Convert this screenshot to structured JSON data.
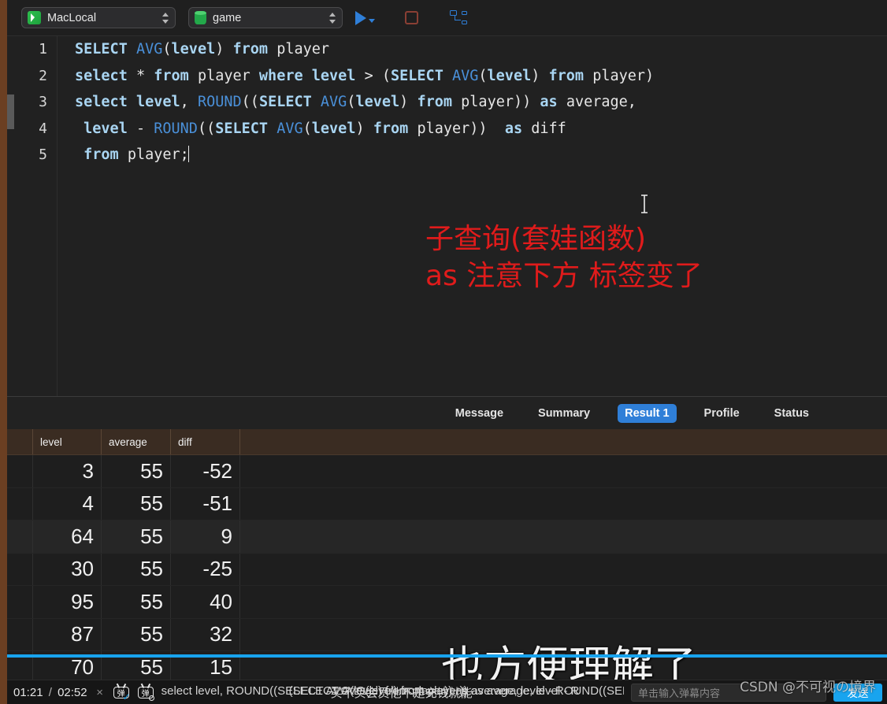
{
  "toolbar": {
    "connection": "MacLocal",
    "database": "game",
    "run_label": "run",
    "stop_label": "stop",
    "plan_label": "explain-plan"
  },
  "editor": {
    "line_numbers": [
      "1",
      "2",
      "3",
      "4",
      "5"
    ],
    "lines": [
      [
        {
          "t": "SELECT ",
          "c": "kw"
        },
        {
          "t": "AVG",
          "c": "fn"
        },
        {
          "t": "(",
          "c": "pl"
        },
        {
          "t": "level",
          "c": "kw"
        },
        {
          "t": ") ",
          "c": "pl"
        },
        {
          "t": "from ",
          "c": "kw"
        },
        {
          "t": "player",
          "c": "pl"
        }
      ],
      [
        {
          "t": "select ",
          "c": "kw"
        },
        {
          "t": "* ",
          "c": "pl"
        },
        {
          "t": "from ",
          "c": "kw"
        },
        {
          "t": "player ",
          "c": "pl"
        },
        {
          "t": "where ",
          "c": "kw"
        },
        {
          "t": "level ",
          "c": "kw"
        },
        {
          "t": "> (",
          "c": "pl"
        },
        {
          "t": "SELECT ",
          "c": "kw"
        },
        {
          "t": "AVG",
          "c": "fn"
        },
        {
          "t": "(",
          "c": "pl"
        },
        {
          "t": "level",
          "c": "kw"
        },
        {
          "t": ") ",
          "c": "pl"
        },
        {
          "t": "from ",
          "c": "kw"
        },
        {
          "t": "player)",
          "c": "pl"
        }
      ],
      [
        {
          "t": "select ",
          "c": "kw"
        },
        {
          "t": "level",
          "c": "kw"
        },
        {
          "t": ", ",
          "c": "pl"
        },
        {
          "t": "ROUND",
          "c": "fn"
        },
        {
          "t": "((",
          "c": "pl"
        },
        {
          "t": "SELECT ",
          "c": "kw"
        },
        {
          "t": "AVG",
          "c": "fn"
        },
        {
          "t": "(",
          "c": "pl"
        },
        {
          "t": "level",
          "c": "kw"
        },
        {
          "t": ") ",
          "c": "pl"
        },
        {
          "t": "from ",
          "c": "kw"
        },
        {
          "t": "player)) ",
          "c": "pl"
        },
        {
          "t": "as ",
          "c": "kw"
        },
        {
          "t": "average,",
          "c": "pl"
        }
      ],
      [
        {
          "t": " level ",
          "c": "kw"
        },
        {
          "t": "- ",
          "c": "pl"
        },
        {
          "t": "ROUND",
          "c": "fn"
        },
        {
          "t": "((",
          "c": "pl"
        },
        {
          "t": "SELECT ",
          "c": "kw"
        },
        {
          "t": "AVG",
          "c": "fn"
        },
        {
          "t": "(",
          "c": "pl"
        },
        {
          "t": "level",
          "c": "kw"
        },
        {
          "t": ") ",
          "c": "pl"
        },
        {
          "t": "from ",
          "c": "kw"
        },
        {
          "t": "player))  ",
          "c": "pl"
        },
        {
          "t": "as ",
          "c": "kw"
        },
        {
          "t": "diff",
          "c": "pl"
        }
      ],
      [
        {
          "t": " from ",
          "c": "kw"
        },
        {
          "t": "player;",
          "c": "pl"
        }
      ]
    ]
  },
  "annotation": {
    "line1": "子查询(套娃函数)",
    "line2": "as 注意下方 标签变了",
    "color": "#e01b1b"
  },
  "result_tabs": {
    "items": [
      "Message",
      "Summary",
      "Result 1",
      "Profile",
      "Status"
    ],
    "active": "Result 1",
    "active_color": "#2f7fd8"
  },
  "result_grid": {
    "columns": [
      "level",
      "average",
      "diff"
    ],
    "rows": [
      {
        "level": "3",
        "average": "55",
        "diff": "-52"
      },
      {
        "level": "4",
        "average": "55",
        "diff": "-51"
      },
      {
        "level": "64",
        "average": "55",
        "diff": "9"
      },
      {
        "level": "30",
        "average": "55",
        "diff": "-25"
      },
      {
        "level": "95",
        "average": "55",
        "diff": "40"
      },
      {
        "level": "87",
        "average": "55",
        "diff": "32"
      },
      {
        "level": "70",
        "average": "55",
        "diff": "15"
      }
    ]
  },
  "danmaku": {
    "big_comment": "也方便理解了",
    "scrolling_comments": [
      "select level, ROUND((SELECT AVG(level) from player)) as average, level - ROUND((SELECT AVG(level) fro",
      "(SELECT AVG(level) from player)) as average, level - R",
      "买不买会员他不是充钱就能"
    ]
  },
  "player": {
    "current_time": "01:21",
    "total_time": "02:52",
    "time_separator": "/",
    "close_label": "×",
    "danmaku_toggle_label": "弹",
    "danmaku_settings_label": "弹",
    "input_placeholder": "单击输入弹幕内容",
    "send_label": "发送",
    "progress_percent": 100,
    "progress_color": "#18a4ef"
  },
  "watermark": "CSDN @不可视の境界"
}
